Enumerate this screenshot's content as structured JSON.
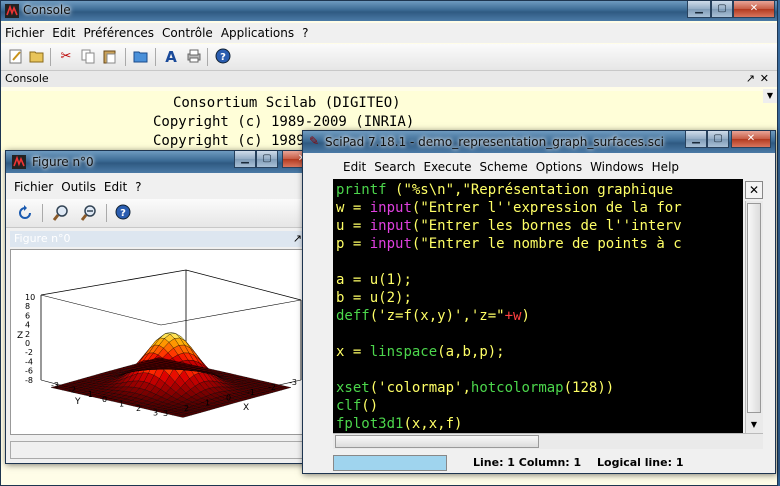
{
  "console": {
    "title": "Console",
    "menu": [
      "Fichier",
      "Edit",
      "Préférences",
      "Contrôle",
      "Applications",
      "?"
    ],
    "panel_title": "Console",
    "lines": [
      "Consortium Scilab (DIGITEO)",
      "Copyright (c) 1989-2009 (INRIA)",
      "Copyright (c) 1989-2007 (ENPC)"
    ]
  },
  "figure": {
    "title": "Figure n°0",
    "menu": [
      "Fichier",
      "Outils",
      "Edit",
      "?"
    ],
    "panel_title": "Figure n°0",
    "z_label": "Z",
    "x_label": "X",
    "y_label": "Y",
    "z_ticks": [
      "10",
      "8",
      "6",
      "4",
      "2",
      "0",
      "-2",
      "-4",
      "-6",
      "-8"
    ],
    "x_ticks": [
      "3",
      "2",
      "1",
      "0",
      "-1",
      "-2",
      "-3"
    ],
    "y_ticks": [
      "-3",
      "-2",
      "-1",
      "0",
      "1",
      "2",
      "3"
    ]
  },
  "scipad": {
    "title": "SciPad 7.18.1 - demo_representation_graph_surfaces.sci",
    "menu": [
      "Edit",
      "Search",
      "Execute",
      "Scheme",
      "Options",
      "Windows",
      "Help"
    ],
    "status_line": "Line: 1 Column: 1",
    "status_logical": "Logical line: 1",
    "code_lines": [
      {
        "segs": [
          {
            "t": "printf",
            "c": "kw"
          },
          {
            "t": " (",
            "c": "pl"
          },
          {
            "t": "\"%s\\n\",\"Représentation graphique",
            "c": "st"
          }
        ]
      },
      {
        "segs": [
          {
            "t": "w",
            "c": "var"
          },
          {
            "t": " = ",
            "c": "pl"
          },
          {
            "t": "input",
            "c": "fn"
          },
          {
            "t": "(",
            "c": "pl"
          },
          {
            "t": "\"Entrer l''expression de la for",
            "c": "st"
          }
        ]
      },
      {
        "segs": [
          {
            "t": "u",
            "c": "var"
          },
          {
            "t": " = ",
            "c": "pl"
          },
          {
            "t": "input",
            "c": "fn"
          },
          {
            "t": "(",
            "c": "pl"
          },
          {
            "t": "\"Entrer les bornes de l''interv",
            "c": "st"
          }
        ]
      },
      {
        "segs": [
          {
            "t": "p",
            "c": "var"
          },
          {
            "t": " = ",
            "c": "pl"
          },
          {
            "t": "input",
            "c": "fn"
          },
          {
            "t": "(",
            "c": "pl"
          },
          {
            "t": "\"Entrer le nombre de points à c",
            "c": "st"
          }
        ]
      },
      {
        "segs": []
      },
      {
        "segs": [
          {
            "t": "a",
            "c": "var"
          },
          {
            "t": " = u(1);",
            "c": "pl"
          }
        ]
      },
      {
        "segs": [
          {
            "t": "b",
            "c": "var"
          },
          {
            "t": " = u(2);",
            "c": "pl"
          }
        ]
      },
      {
        "segs": [
          {
            "t": "deff",
            "c": "kw"
          },
          {
            "t": "(",
            "c": "pl"
          },
          {
            "t": "'z=f(x,y)','z=\"",
            "c": "st"
          },
          {
            "t": "+w",
            "c": "op"
          },
          {
            "t": ")",
            "c": "pl"
          }
        ]
      },
      {
        "segs": []
      },
      {
        "segs": [
          {
            "t": "x",
            "c": "var"
          },
          {
            "t": " = ",
            "c": "pl"
          },
          {
            "t": "linspace",
            "c": "kw"
          },
          {
            "t": "(a,b,p);",
            "c": "pl"
          }
        ]
      },
      {
        "segs": []
      },
      {
        "segs": [
          {
            "t": "xset",
            "c": "kw"
          },
          {
            "t": "(",
            "c": "pl"
          },
          {
            "t": "'colormap'",
            "c": "st"
          },
          {
            "t": ",",
            "c": "pl"
          },
          {
            "t": "hotcolormap",
            "c": "kw"
          },
          {
            "t": "(128))",
            "c": "pl"
          }
        ]
      },
      {
        "segs": [
          {
            "t": "clf",
            "c": "kw"
          },
          {
            "t": "()",
            "c": "pl"
          }
        ]
      },
      {
        "segs": [
          {
            "t": "fplot3d1",
            "c": "kw"
          },
          {
            "t": "(x,x,f)",
            "c": "pl"
          }
        ]
      }
    ]
  },
  "colors": {
    "code_bg": "#000000",
    "kw": "#4cd64c",
    "fn": "#e040e0",
    "st": "#ffff66",
    "pl": "#ffff66",
    "var": "#ffff66",
    "op": "#ff4040"
  }
}
